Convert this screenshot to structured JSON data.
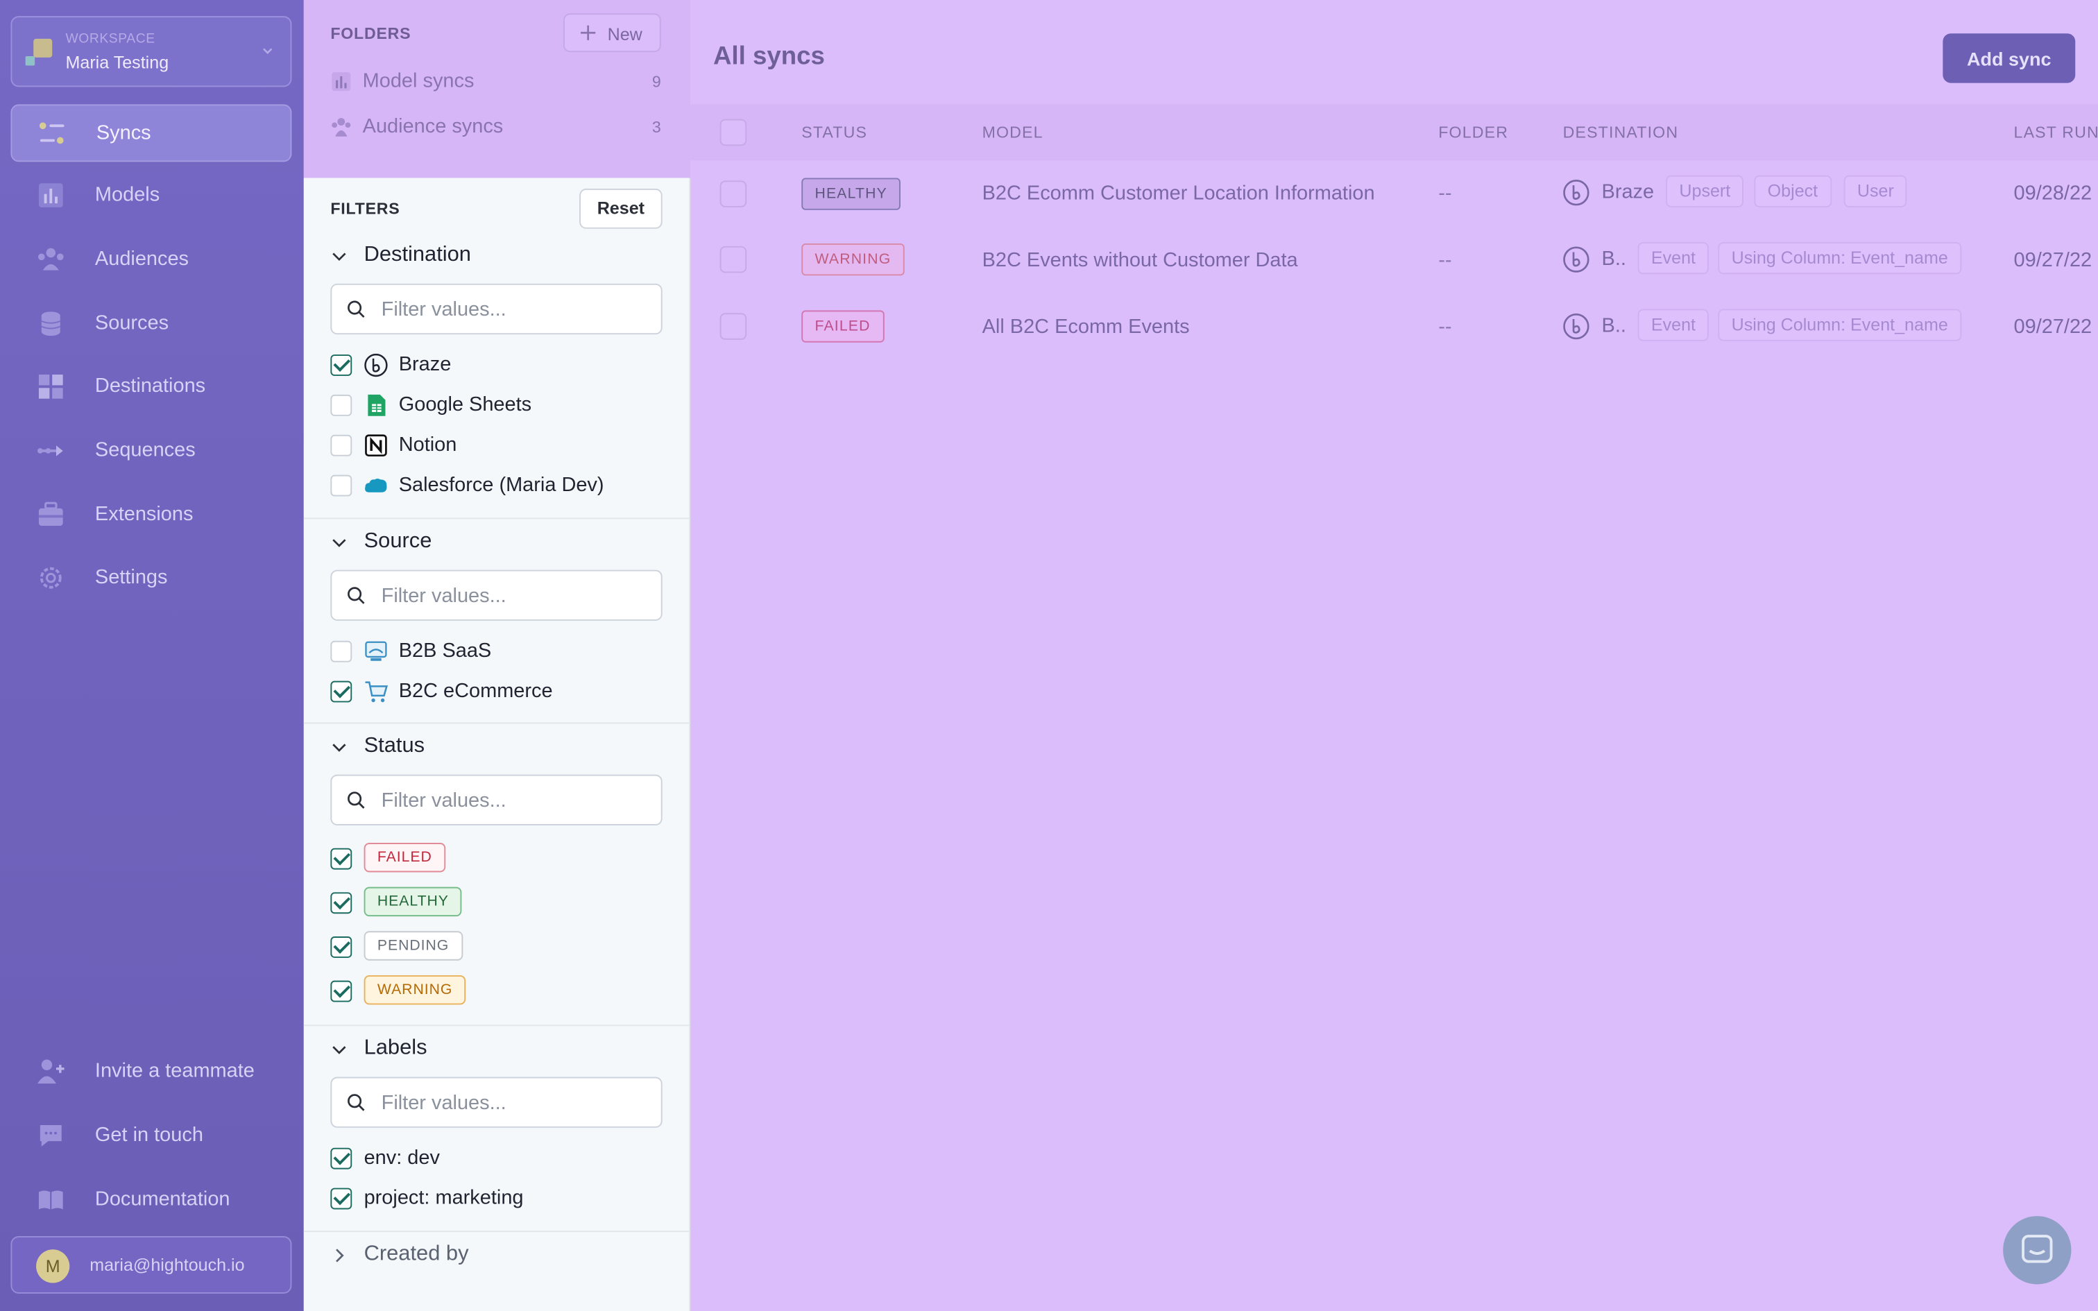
{
  "workspace": {
    "label": "WORKSPACE",
    "name": "Maria Testing"
  },
  "nav": {
    "items": [
      {
        "label": "Syncs",
        "icon": "syncs-icon",
        "active": true
      },
      {
        "label": "Models",
        "icon": "models-icon"
      },
      {
        "label": "Audiences",
        "icon": "audiences-icon"
      },
      {
        "label": "Sources",
        "icon": "sources-icon"
      },
      {
        "label": "Destinations",
        "icon": "destinations-icon"
      },
      {
        "label": "Sequences",
        "icon": "sequences-icon"
      },
      {
        "label": "Extensions",
        "icon": "extensions-icon"
      },
      {
        "label": "Settings",
        "icon": "settings-icon"
      }
    ],
    "bottom": [
      {
        "label": "Invite a teammate",
        "icon": "invite-icon"
      },
      {
        "label": "Get in touch",
        "icon": "chat-icon"
      },
      {
        "label": "Documentation",
        "icon": "book-icon"
      }
    ],
    "user": {
      "initial": "M",
      "email": "maria@hightouch.io"
    }
  },
  "folders": {
    "title": "FOLDERS",
    "new_label": "New",
    "items": [
      {
        "label": "Model syncs",
        "count": "9"
      },
      {
        "label": "Audience syncs",
        "count": "3"
      }
    ]
  },
  "filters": {
    "title": "FILTERS",
    "reset_label": "Reset",
    "placeholder": "Filter values...",
    "destination": {
      "label": "Destination",
      "options": [
        {
          "label": "Braze",
          "checked": true
        },
        {
          "label": "Google Sheets",
          "checked": false
        },
        {
          "label": "Notion",
          "checked": false
        },
        {
          "label": "Salesforce (Maria Dev)",
          "checked": false
        }
      ]
    },
    "source": {
      "label": "Source",
      "options": [
        {
          "label": "B2B SaaS",
          "checked": false
        },
        {
          "label": "B2C eCommerce",
          "checked": true
        }
      ]
    },
    "status": {
      "label": "Status",
      "options": [
        {
          "label": "FAILED",
          "checked": true
        },
        {
          "label": "HEALTHY",
          "checked": true
        },
        {
          "label": "PENDING",
          "checked": true
        },
        {
          "label": "WARNING",
          "checked": true
        }
      ]
    },
    "labels": {
      "label": "Labels",
      "options": [
        {
          "label": "env: dev",
          "checked": true
        },
        {
          "label": "project: marketing",
          "checked": true
        }
      ]
    },
    "created_by": {
      "label": "Created by"
    }
  },
  "main": {
    "title": "All syncs",
    "add_label": "Add sync",
    "columns": [
      "STATUS",
      "MODEL",
      "FOLDER",
      "DESTINATION",
      "LAST RUN"
    ],
    "rows": [
      {
        "status": "HEALTHY",
        "model": "B2C Ecomm Customer Location Information",
        "folder": "--",
        "destination": "Braze",
        "tags": [
          "Upsert",
          "Object",
          "User"
        ],
        "last_run": "09/28/22"
      },
      {
        "status": "WARNING",
        "model": "B2C Events without Customer Data",
        "folder": "--",
        "destination": "B..",
        "tags": [
          "Event",
          "Using Column: Event_name"
        ],
        "last_run": "09/27/22"
      },
      {
        "status": "FAILED",
        "model": "All B2C Ecomm Events",
        "folder": "--",
        "destination": "B..",
        "tags": [
          "Event",
          "Using Column: Event_name"
        ],
        "last_run": "09/27/22"
      }
    ]
  },
  "colors": {
    "sidebar": "#7064be",
    "overlay": "#dcbdfc",
    "checkbox_on": "#1a6b60",
    "primary_button": "#6c5fb4"
  }
}
